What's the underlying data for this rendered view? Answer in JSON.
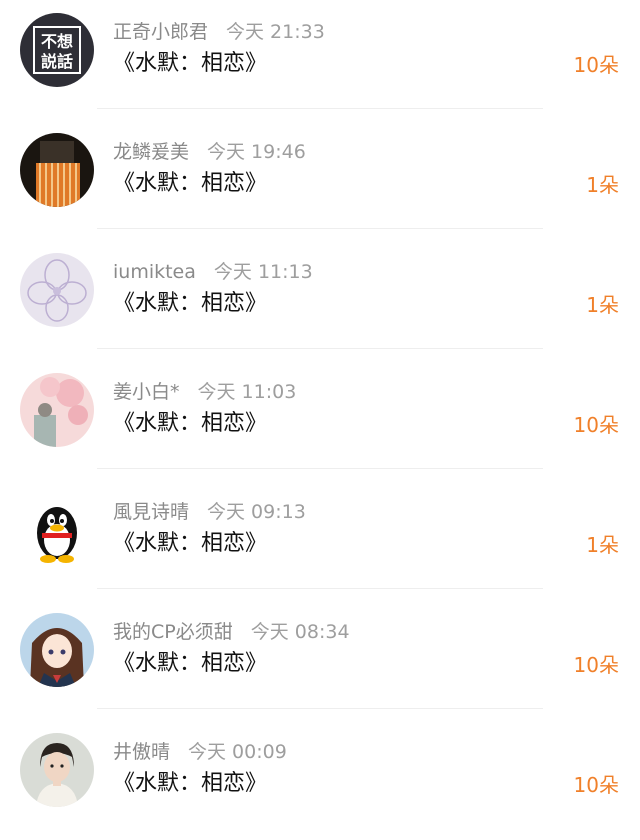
{
  "records": [
    {
      "name": "正奇小郎君",
      "time": "今天 21:33",
      "gift": "《水默：相恋》",
      "count": "10朵",
      "avatar": "text-avatar",
      "avatar_text": [
        "不想",
        "説話"
      ]
    },
    {
      "name": "龙鳞爰美",
      "time": "今天 19:46",
      "gift": "《水默：相恋》",
      "count": "1朵",
      "avatar": "photo-avatar"
    },
    {
      "name": "iumiktea",
      "time": "今天 11:13",
      "gift": "《水默：相恋》",
      "count": "1朵",
      "avatar": "flower-avatar"
    },
    {
      "name": "姜小白*",
      "time": "今天 11:03",
      "gift": "《水默：相恋》",
      "count": "10朵",
      "avatar": "blossom-avatar"
    },
    {
      "name": "風見诗晴",
      "time": "今天 09:13",
      "gift": "《水默：相恋》",
      "count": "1朵",
      "avatar": "qq-penguin-avatar"
    },
    {
      "name": "我的CP必须甜",
      "time": "今天 08:34",
      "gift": "《水默：相恋》",
      "count": "10朵",
      "avatar": "anime-girl-avatar"
    },
    {
      "name": "井傲晴",
      "time": "今天 00:09",
      "gift": "《水默：相恋》",
      "count": "10朵",
      "avatar": "portrait-avatar"
    }
  ]
}
